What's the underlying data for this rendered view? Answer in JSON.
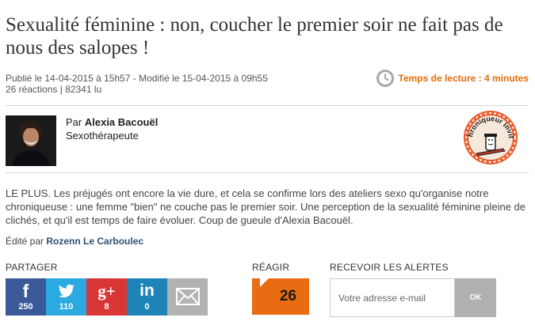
{
  "article": {
    "title": "Sexualité féminine : non, coucher le premier soir ne fait pas de nous des salopes !",
    "published": "Publié le 14-04-2015 à 15h57 - Modifié le 15-04-2015 à 09h55",
    "stats": "26 réactions | 82341 lu",
    "reading_time": "Temps de lecture : 4 minutes",
    "intro": "LE PLUS. Les préjugés ont encore la vie dure, et cela se confirme lors des ateliers sexo qu'organise notre chroniqueuse : une femme \"bien\" ne couche pas le premier soir. Une perception de la sexualité féminine pleine de clichés, et qu'il est temps de faire évoluer. Coup de gueule d'Alexia Bacouël.",
    "edited_prefix": "Édité par",
    "editor": "Rozenn Le Carboulec"
  },
  "author": {
    "prefix": "Par",
    "name": "Alexia Bacouël",
    "role": "Sexothérapeute"
  },
  "badge": {
    "text": "Chroniqueur Invité"
  },
  "share": {
    "label": "PARTAGER",
    "buttons": [
      {
        "icon": "facebook-icon",
        "glyph": "f",
        "count": "250",
        "color": "#3b5998"
      },
      {
        "icon": "twitter-icon",
        "glyph": "",
        "count": "110",
        "color": "#2ba9e1"
      },
      {
        "icon": "google-plus-icon",
        "glyph": "g+",
        "count": "8",
        "color": "#d93636"
      },
      {
        "icon": "linkedin-icon",
        "glyph": "in",
        "count": "0",
        "color": "#1e83b7"
      },
      {
        "icon": "email-icon",
        "glyph": "",
        "count": "",
        "color": "#b2b2b2"
      }
    ]
  },
  "react": {
    "label": "RÉAGIR",
    "count": "26"
  },
  "alerts": {
    "label": "RECEVOIR LES ALERTES",
    "placeholder": "Votre adresse e-mail",
    "ok": "OK"
  },
  "colors": {
    "accent_orange": "#e36c0a",
    "react_orange": "#e96c12",
    "editor_blue": "#2c4f73"
  }
}
